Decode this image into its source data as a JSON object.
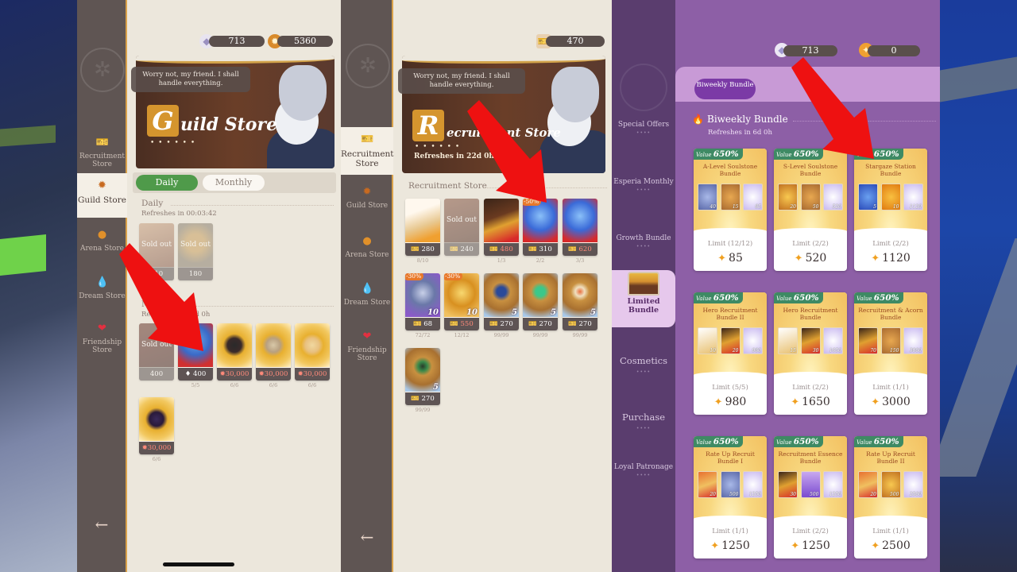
{
  "guild_panel": {
    "sidebar": {
      "items": [
        {
          "label": "Recruitment Store",
          "icon": "recruitment-ticket-icon",
          "active": false
        },
        {
          "label": "Guild Store",
          "icon": "guild-coin-icon",
          "active": true
        },
        {
          "label": "Arena Store",
          "icon": "arena-coin-icon",
          "active": false
        },
        {
          "label": "Dream Store",
          "icon": "dream-drop-icon",
          "active": false
        },
        {
          "label": "Friendship Store",
          "icon": "heart-icon",
          "active": false
        }
      ],
      "back_icon": "back-arrow-icon"
    },
    "currencies": [
      {
        "icon": "diamond-icon",
        "value": "713"
      },
      {
        "icon": "guild-coin-icon",
        "value": "5360"
      }
    ],
    "banner": {
      "speech": "Worry not, my friend. I shall handle everything.",
      "letter": "G",
      "title": "uild Store",
      "dots": "• • • • • •"
    },
    "tabs": [
      {
        "label": "Daily",
        "active": true
      },
      {
        "label": "Monthly",
        "active": false
      }
    ],
    "daily": {
      "title": "Daily",
      "refresh": "Refreshes in 00:03:42",
      "items": [
        {
          "sold_out": true,
          "sold_label": "Sold out",
          "price": "210",
          "stock": ""
        },
        {
          "sold_out": true,
          "sold_label": "Sold out",
          "price": "180",
          "stock": ""
        }
      ]
    },
    "monthly": {
      "title": "Monthly",
      "refresh": "Refreshes in 22d 0h",
      "items": [
        {
          "sold_out": true,
          "sold_label": "Sold out",
          "price": "400",
          "stock": ""
        },
        {
          "sold_out": false,
          "price": "400",
          "stock": "5/5"
        },
        {
          "sold_out": false,
          "price": "30,000",
          "stock": "6/6"
        },
        {
          "sold_out": false,
          "price": "30,000",
          "stock": "6/6"
        },
        {
          "sold_out": false,
          "price": "30,000",
          "stock": "6/6"
        },
        {
          "sold_out": false,
          "price": "30,000",
          "stock": "6/6"
        }
      ]
    }
  },
  "recruit_panel": {
    "sidebar": {
      "items": [
        {
          "label": "Recruitment Store",
          "active": true
        },
        {
          "label": "Guild Store",
          "active": false
        },
        {
          "label": "Arena Store",
          "active": false
        },
        {
          "label": "Dream Store",
          "active": false
        },
        {
          "label": "Friendship Store",
          "active": false
        }
      ]
    },
    "currency": {
      "icon": "recruitment-ticket-icon",
      "value": "470"
    },
    "banner": {
      "speech": "Worry not, my friend. I shall handle everything.",
      "letter": "R",
      "title": "ecruitment Store",
      "dots": "• • • • • •",
      "refresh": "Refreshes in 22d 0h"
    },
    "section_title": "Recruitment Store",
    "items": [
      {
        "price": "280",
        "stock": "8/10",
        "sold_out": false,
        "discount": "",
        "count": "",
        "red": false
      },
      {
        "price": "240",
        "stock": "",
        "sold_out": true,
        "sold_label": "Sold out",
        "discount": "",
        "count": "",
        "red": false
      },
      {
        "price": "480",
        "stock": "1/3",
        "sold_out": false,
        "discount": "",
        "count": "",
        "red": true
      },
      {
        "price": "310",
        "stock": "2/2",
        "sold_out": false,
        "discount": "-50%",
        "count": "",
        "red": false
      },
      {
        "price": "620",
        "stock": "3/3",
        "sold_out": false,
        "discount": "",
        "count": "",
        "red": true
      },
      {
        "price": "68",
        "stock": "72/72",
        "sold_out": false,
        "discount": "-30%",
        "count": "10",
        "red": false
      },
      {
        "price": "550",
        "stock": "12/12",
        "sold_out": false,
        "discount": "-30%",
        "count": "10",
        "red": true
      },
      {
        "price": "270",
        "stock": "99/99",
        "sold_out": false,
        "discount": "",
        "count": "5",
        "red": false
      },
      {
        "price": "270",
        "stock": "99/99",
        "sold_out": false,
        "discount": "",
        "count": "5",
        "red": false
      },
      {
        "price": "270",
        "stock": "99/99",
        "sold_out": false,
        "discount": "",
        "count": "5",
        "red": false
      },
      {
        "price": "270",
        "stock": "99/99",
        "sold_out": false,
        "discount": "",
        "count": "5",
        "red": false
      }
    ]
  },
  "bundle_panel": {
    "sidebar": {
      "items": [
        {
          "label": "Special Offers",
          "active": false
        },
        {
          "label": "Esperia Monthly",
          "active": false
        },
        {
          "label": "Growth Bundle",
          "active": false
        },
        {
          "label": "Limited Bundle",
          "active": true
        },
        {
          "label": "Cosmetics",
          "active": false
        },
        {
          "label": "Purchase",
          "active": false
        },
        {
          "label": "Loyal Patronage",
          "active": false
        }
      ]
    },
    "currencies": [
      {
        "icon": "diamond-icon",
        "value": "713"
      },
      {
        "icon": "gold-essence-icon",
        "value": "0"
      }
    ],
    "tab_pill": "Biweekly Bundle",
    "section_title": "Biweekly Bundle",
    "section_refresh": "Refreshes in 6d 0h",
    "value_label": "Value",
    "cards": [
      {
        "value": "650%",
        "name": "A-Level Soulstone Bundle",
        "limit": "Limit (12/12)",
        "price": "85",
        "qty": [
          "40",
          "15",
          "85"
        ]
      },
      {
        "value": "650%",
        "name": "S-Level Soulstone Bundle",
        "limit": "Limit (2/2)",
        "price": "520",
        "qty": [
          "20",
          "50",
          "520"
        ]
      },
      {
        "value": "650%",
        "name": "Stargaze Station Bundle",
        "limit": "Limit (2/2)",
        "price": "1120",
        "qty": [
          "5",
          "10",
          "1120"
        ]
      },
      {
        "value": "650%",
        "name": "Hero Recruitment Bundle II",
        "limit": "Limit (5/5)",
        "price": "980",
        "qty": [
          "10",
          "20",
          "980"
        ]
      },
      {
        "value": "650%",
        "name": "Hero Recruitment Bundle",
        "limit": "Limit (2/2)",
        "price": "1650",
        "qty": [
          "15",
          "30",
          "1650"
        ]
      },
      {
        "value": "650%",
        "name": "Recruitment & Acorn Bundle",
        "limit": "Limit (1/1)",
        "price": "3000",
        "qty": [
          "70",
          "150",
          "3000"
        ]
      },
      {
        "value": "650%",
        "name": "Rate Up Recruit Bundle I",
        "limit": "Limit (1/1)",
        "price": "1250",
        "qty": [
          "20",
          "500",
          "1250"
        ]
      },
      {
        "value": "650%",
        "name": "Recruitment Essence Bundle",
        "limit": "Limit (2/2)",
        "price": "1250",
        "qty": [
          "30",
          "500",
          "1250"
        ]
      },
      {
        "value": "650%",
        "name": "Rate Up Recruit Bundle II",
        "limit": "Limit (1/1)",
        "price": "2500",
        "qty": [
          "20",
          "500",
          "2500"
        ]
      }
    ]
  },
  "colors": {
    "red_arrow": "#ee1111",
    "active_tab_green": "#4f9a4a",
    "value_badge_green": "#3e8a64",
    "purple_panel": "#8d5fa6"
  }
}
